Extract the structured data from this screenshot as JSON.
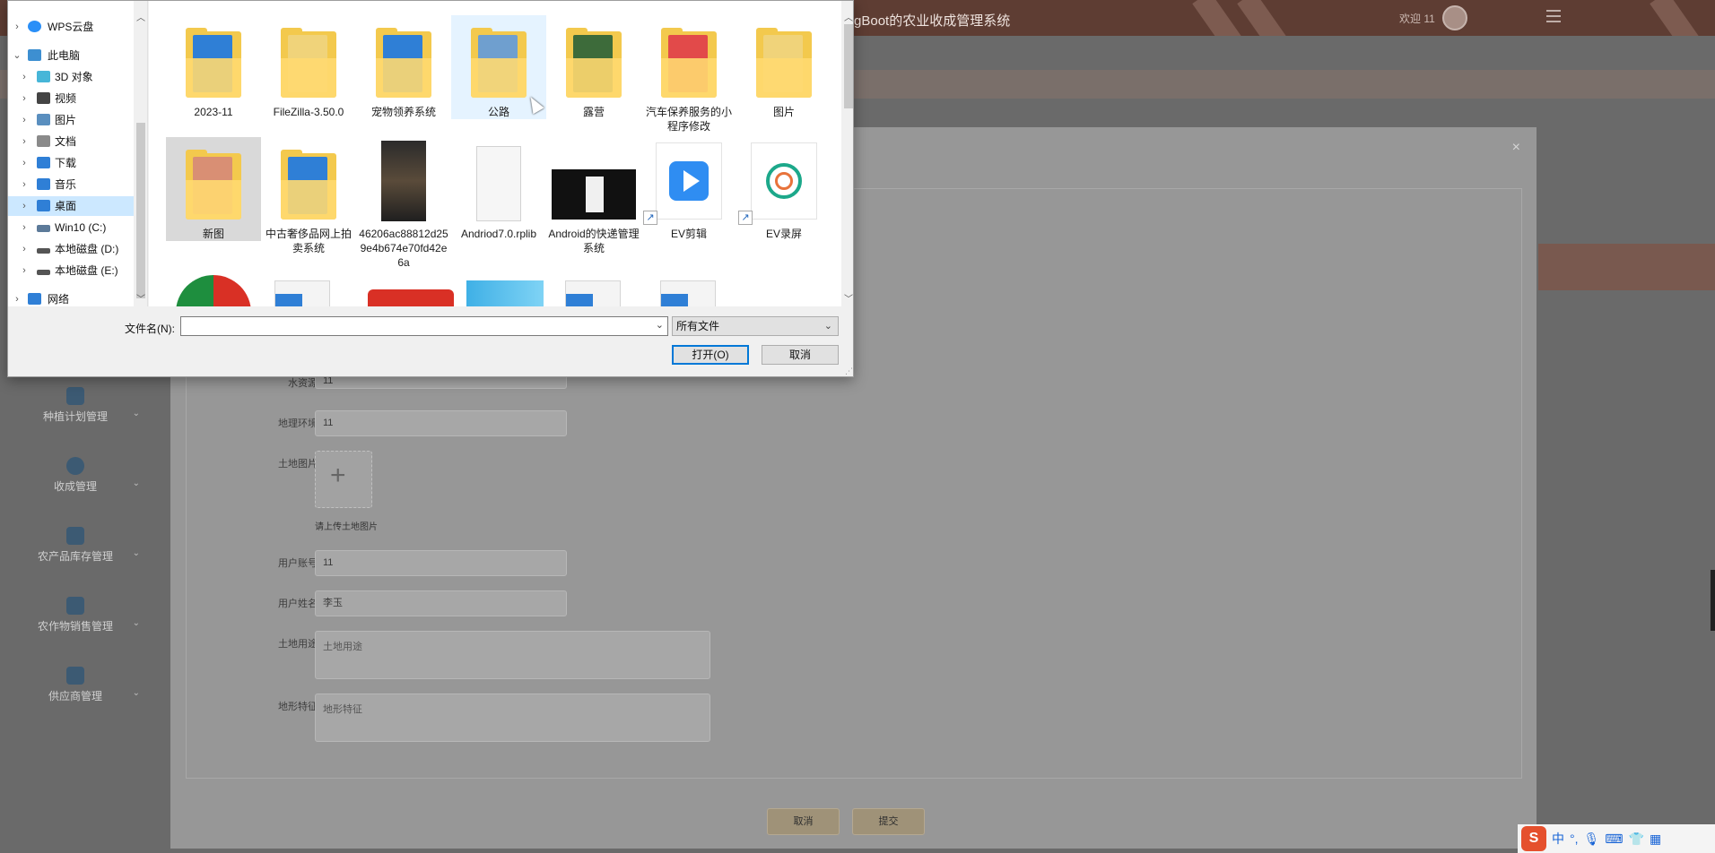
{
  "app": {
    "title": "gBoot的农业收成管理系统",
    "welcome": "欢迎 11"
  },
  "sidebar": {
    "items": [
      {
        "label": "种植计划管理",
        "icon": "ticket-icon"
      },
      {
        "label": "收成管理",
        "icon": "compass-icon"
      },
      {
        "label": "农产品库存管理",
        "icon": "grid-icon"
      },
      {
        "label": "农作物销售管理",
        "icon": "briefcase-icon"
      },
      {
        "label": "供应商管理",
        "icon": "chart-icon"
      }
    ]
  },
  "form": {
    "water_label": "水资源",
    "water_value": "11",
    "geo_label": "地理环境",
    "geo_value": "11",
    "image_label": "土地图片",
    "image_hint": "请上传土地图片",
    "account_label": "用户账号",
    "account_value": "11",
    "name_label": "用户姓名",
    "name_value": "李玉",
    "usage_label": "土地用途",
    "usage_placeholder": "土地用途",
    "terrain_label": "地形特征",
    "terrain_placeholder": "地形特征",
    "cancel": "取消",
    "submit": "提交"
  },
  "dialog": {
    "tree": [
      {
        "label": "WPS云盘",
        "icon": "cloud-icon",
        "color": "#2a8ff7"
      },
      {
        "label": "此电脑",
        "icon": "computer-icon",
        "color": "#3d8fd1"
      },
      {
        "label": "3D 对象",
        "icon": "cube-icon",
        "color": "#47b6d8"
      },
      {
        "label": "视频",
        "icon": "film-icon",
        "color": "#444444"
      },
      {
        "label": "图片",
        "icon": "picture-icon",
        "color": "#5a8fbf"
      },
      {
        "label": "文档",
        "icon": "document-icon",
        "color": "#8a8a8a"
      },
      {
        "label": "下载",
        "icon": "download-icon",
        "color": "#2f7fd6"
      },
      {
        "label": "音乐",
        "icon": "music-icon",
        "color": "#2f7fd6"
      },
      {
        "label": "桌面",
        "icon": "desktop-icon",
        "color": "#2f7fd6"
      },
      {
        "label": "Win10 (C:)",
        "icon": "drive-icon",
        "color": "#5c7a99"
      },
      {
        "label": "本地磁盘 (D:)",
        "icon": "drive-icon",
        "color": "#555555"
      },
      {
        "label": "本地磁盘 (E:)",
        "icon": "drive-icon",
        "color": "#555555"
      },
      {
        "label": "网络",
        "icon": "network-icon",
        "color": "#2f7fd6"
      }
    ],
    "files": [
      {
        "name": "2023-11",
        "kind": "folder",
        "paper": "#2f7fd6"
      },
      {
        "name": "FileZilla-3.50.0",
        "kind": "folder",
        "paper": "#f0d37a"
      },
      {
        "name": "宠物领养系统",
        "kind": "folder",
        "paper": "#2f7fd6"
      },
      {
        "name": "公路",
        "kind": "folder",
        "paper": "#6f9fcf"
      },
      {
        "name": "露营",
        "kind": "folder",
        "paper": "#3d6b3a"
      },
      {
        "name": "汽车保养服务的小程序修改",
        "kind": "folder",
        "paper": "#e24a4a"
      },
      {
        "name": "图片",
        "kind": "folder",
        "paper": "#f0d37a"
      },
      {
        "name": "新图",
        "kind": "folder",
        "paper": "#d98f74"
      },
      {
        "name": "中古奢侈品网上拍卖系统",
        "kind": "folder",
        "paper": "#2f7fd6"
      },
      {
        "name": "46206ac88812d259e4b674e70fd42e6a",
        "kind": "photo"
      },
      {
        "name": "Andriod7.0.rplib",
        "kind": "doc"
      },
      {
        "name": "Android的快递管理系统",
        "kind": "video"
      },
      {
        "name": "EV剪辑",
        "kind": "app",
        "color": "#2f8df2"
      },
      {
        "name": "EV录屏",
        "kind": "app",
        "color": "#1ca88a"
      }
    ],
    "filename_label": "文件名(N):",
    "filename_value": "",
    "filetype": "所有文件",
    "open": "打开(O)",
    "cancel": "取消"
  },
  "ime": {
    "lang": "中"
  }
}
